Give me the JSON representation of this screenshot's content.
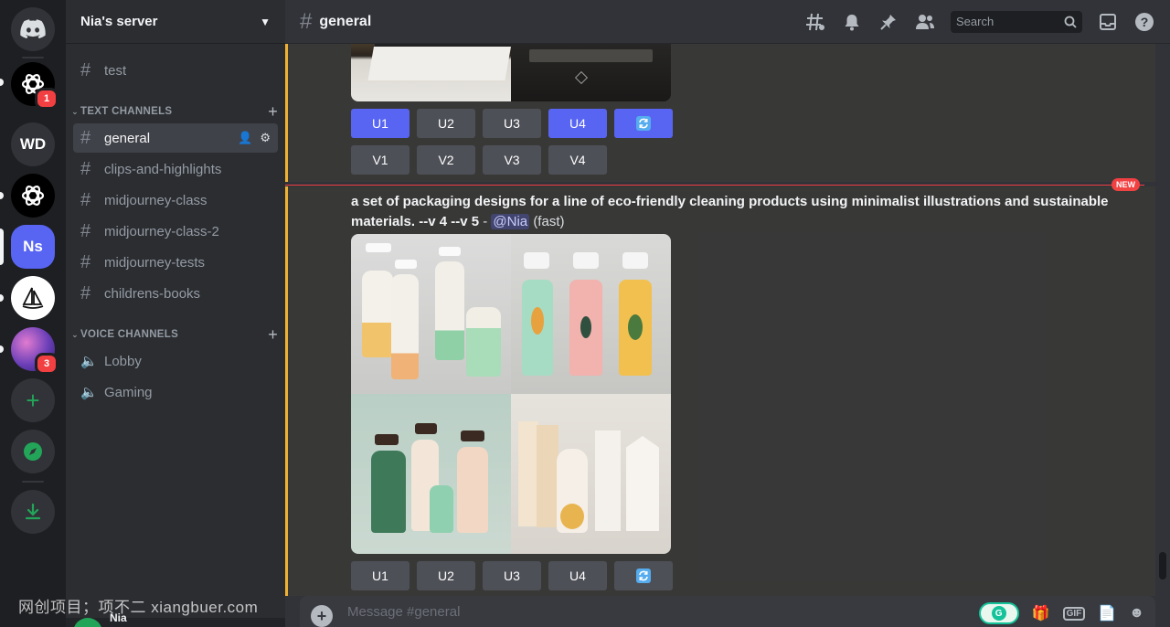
{
  "server_rail": {
    "servers": [
      {
        "id": "discord-home",
        "label": "",
        "icon": "discord-logo-icon"
      },
      {
        "id": "openai-1",
        "label": "",
        "icon": "openai-logo-icon",
        "badge": "1"
      },
      {
        "id": "wd",
        "label": "WD"
      },
      {
        "id": "openai-2",
        "label": "",
        "icon": "openai-logo-icon"
      },
      {
        "id": "ns",
        "label": "Ns"
      },
      {
        "id": "midjourney",
        "label": "",
        "icon": "sailboat-icon"
      },
      {
        "id": "galaxy",
        "label": "",
        "icon": "galaxy-avatar",
        "badge": "3"
      }
    ],
    "add_server_icon": "plus-icon",
    "explore_icon": "compass-icon",
    "download_icon": "download-icon"
  },
  "sidebar": {
    "server_name": "Nia's server",
    "top_channels": [
      {
        "name": "test"
      }
    ],
    "text_category": "TEXT CHANNELS",
    "text_channels": [
      {
        "name": "general",
        "active": true
      },
      {
        "name": "clips-and-highlights"
      },
      {
        "name": "midjourney-class"
      },
      {
        "name": "midjourney-class-2"
      },
      {
        "name": "midjourney-tests"
      },
      {
        "name": "childrens-books"
      }
    ],
    "voice_category": "VOICE CHANNELS",
    "voice_channels": [
      {
        "name": "Lobby"
      },
      {
        "name": "Gaming"
      }
    ]
  },
  "header": {
    "channel_name": "general",
    "search_placeholder": "Search"
  },
  "messages": {
    "first_buttons_row1": [
      "U1",
      "U2",
      "U3",
      "U4"
    ],
    "first_buttons_row2": [
      "V1",
      "V2",
      "V3",
      "V4"
    ],
    "new_marker": "NEW",
    "prompt_text": "a set of packaging designs for a line of eco-friendly cleaning products using minimalist illustrations and sustainable materials. --v 4 --v 5",
    "separator": " - ",
    "mention": "@Nia",
    "speed": "(fast)",
    "second_buttons_row1": [
      "U1",
      "U2",
      "U3",
      "U4"
    ]
  },
  "composer": {
    "placeholder": "Message #general",
    "gif_label": "GIF"
  },
  "user": {
    "name": "Nia"
  },
  "watermark": "网创项目；项不二 xiangbuer.com",
  "colors": {
    "accent": "#5865f2",
    "highlight": "#f0b232",
    "new_marker": "#f23f42",
    "ns_server": "#5865f2"
  }
}
